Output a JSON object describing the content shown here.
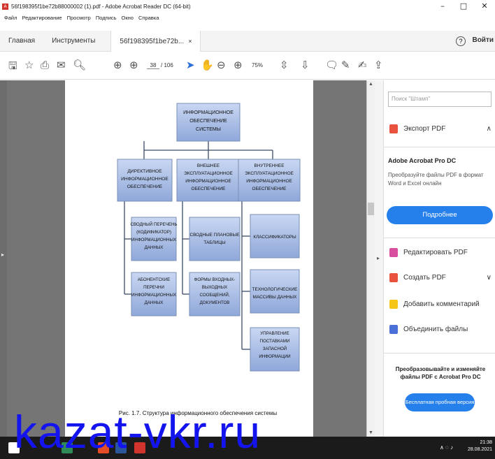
{
  "window": {
    "title": "56f198395f1be72b88000002 (1).pdf - Adobe Acrobat Reader DC (64-bit)",
    "controls": [
      "–",
      "□",
      "✕"
    ]
  },
  "menu": [
    "Файл",
    "Редактирование",
    "Просмотр",
    "Подпись",
    "Окно",
    "Справка"
  ],
  "tabs": {
    "home": "Главная",
    "tools": "Инструменты",
    "document": "56f198395f1be72b...",
    "close": "×"
  },
  "header": {
    "help": "?",
    "login": "Войти"
  },
  "toolbar": {
    "page_current": "38",
    "page_total": "/ 106",
    "zoom": "75%"
  },
  "diagram": {
    "root": "ИНФОРМАЦИОННОЕ ОБЕСПЕЧЕНИЕ СИСТЕМЫ",
    "columns": [
      {
        "title": "ДИРЕКТИВНОЕ ИНФОРМАЦИОННОЕ ОБЕСПЕЧЕНИЕ",
        "items": [
          "СВОДНЫЙ ПЕРЕЧЕНЬ (КОДИФИКАТОР) ИНФОРМАЦИОННЫХ ДАННЫХ",
          "АБОНЕНТСКИЕ ПЕРЕЧНИ ИНФОРМАЦИОННЫХ ДАННЫХ"
        ]
      },
      {
        "title": "ВНЕШНЕЕ ЭКСПЛУАТАЦИОННОЕ ИНФОРМАЦИОННОЕ ОБЕСПЕЧЕНИЕ",
        "items": [
          "СВОДНЫЕ ПЛАНОВЫЕ ТАБЛИЦЫ",
          "ФОРМЫ ВХОДНЫХ-ВЫХОДНЫХ СООБЩЕНИЙ, ДОКУМЕНТОВ"
        ]
      },
      {
        "title": "ВНУТРЕННЕЕ ЭКСПЛУАТАЦИОННОЕ ИНФОРМАЦИОННОЕ ОБЕСПЕЧЕНИЕ",
        "items": [
          "КЛАССИФИКАТОРЫ",
          "ТЕХНОЛОГИЧЕСКИЕ МАССИВЫ ДАННЫХ",
          "УПРАВЛЕНИЕ ПОСТАВКАМИ ЗАПАСНОЙ ИНФОРМАЦИИ"
        ]
      }
    ],
    "caption": "Рис. 1.7. Структура информационного обеспечения системы"
  },
  "panel": {
    "search_placeholder": "Поиск \"Штамп\"",
    "export": "Экспорт PDF",
    "acrobat_title": "Adobe Acrobat Pro DC",
    "acrobat_desc": "Преобразуйте файлы PDF в формат Word и Excel онлайн",
    "more_button": "Подробнее",
    "edit": "Редактировать PDF",
    "create": "Создать PDF",
    "comment": "Добавить комментарий",
    "combine": "Объединить файлы",
    "promo": "Преобразовывайте и изменяйте файлы PDF с Acrobat Pro DC",
    "trial_button": "Бесплатная пробная версия"
  },
  "taskbar": {
    "time": "21:38",
    "date": "28.08.2021"
  },
  "watermark": "kazat-vkr.ru",
  "colors": {
    "accent": "#2680eb",
    "box_fill": "#a9bfe6",
    "watermark": "#1414ee"
  }
}
